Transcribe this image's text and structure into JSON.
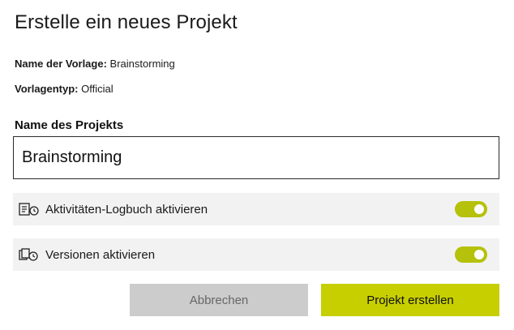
{
  "dialog": {
    "title": "Erstelle ein neues Projekt",
    "template_name_label": "Name der Vorlage:",
    "template_name_value": "Brainstorming",
    "template_type_label": "Vorlagentyp:",
    "template_type_value": "Official",
    "project_name_label": "Name des Projekts",
    "project_name_value": "Brainstorming"
  },
  "toggles": [
    {
      "label": "Aktivitäten-Logbuch aktivieren",
      "icon": "activity-log-icon",
      "enabled": true
    },
    {
      "label": "Versionen aktivieren",
      "icon": "versions-icon",
      "enabled": true
    }
  ],
  "buttons": {
    "cancel_label": "Abbrechen",
    "create_label": "Projekt erstellen"
  },
  "colors": {
    "accent": "#c7cf00",
    "switch_on": "#b5c10a",
    "cancel_bg": "#cccccc",
    "row_bg": "#f2f2f2"
  }
}
